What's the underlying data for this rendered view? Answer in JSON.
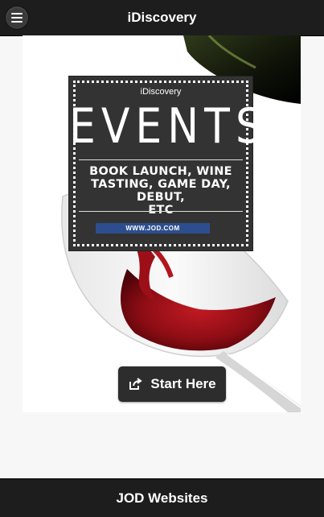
{
  "header": {
    "title": "iDiscovery",
    "menu_icon": "hamburger-menu-icon"
  },
  "hero": {
    "image": "red-wine-pouring-into-glass",
    "card": {
      "brand": "iDiscovery",
      "headline": "EVENTS",
      "subtitle_lines": [
        "BOOK LAUNCH, WINE",
        "TASTING, GAME DAY, DEBUT,",
        "ETC"
      ],
      "url": "WWW.JOD.COM"
    }
  },
  "cta": {
    "label": "Start Here",
    "icon": "share-icon"
  },
  "footer": {
    "label": "JOD Websites"
  },
  "colors": {
    "bar": "#1d1d1d",
    "card": "#333333",
    "url_strip": "#2d4e8e",
    "wine": "#8e0d15"
  }
}
